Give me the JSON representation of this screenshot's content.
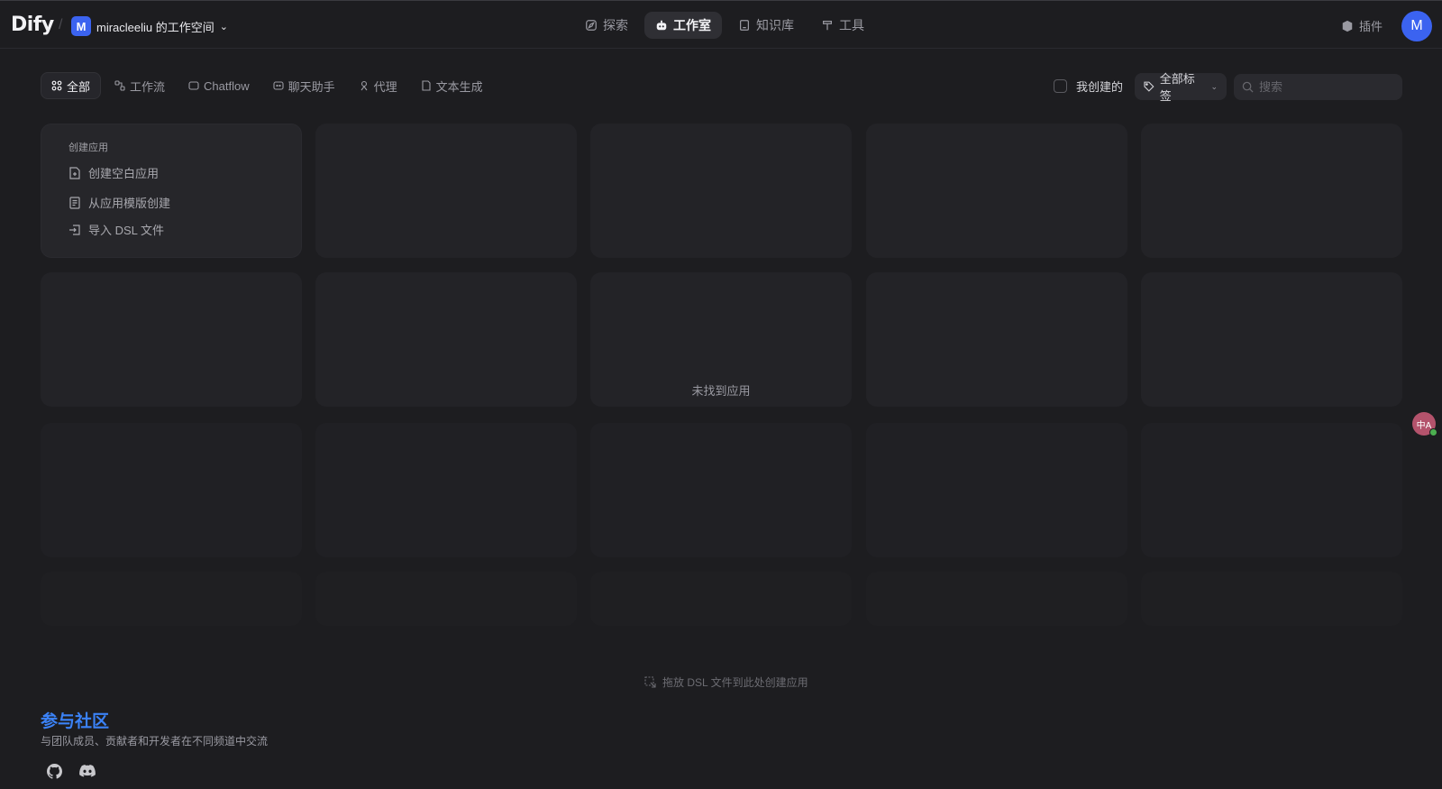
{
  "header": {
    "logo": "Dify",
    "workspace": {
      "initial": "M",
      "name": "miracleeliu 的工作空间"
    },
    "nav": [
      {
        "label": "探索",
        "icon": "explore-icon",
        "active": false
      },
      {
        "label": "工作室",
        "icon": "robot-icon",
        "active": true
      },
      {
        "label": "知识库",
        "icon": "book-icon",
        "active": false
      },
      {
        "label": "工具",
        "icon": "hammer-icon",
        "active": false
      }
    ],
    "plugins_label": "插件",
    "user_initial": "M"
  },
  "filters": {
    "tabs": [
      {
        "label": "全部",
        "active": true
      },
      {
        "label": "工作流",
        "active": false
      },
      {
        "label": "Chatflow",
        "active": false
      },
      {
        "label": "聊天助手",
        "active": false
      },
      {
        "label": "代理",
        "active": false
      },
      {
        "label": "文本生成",
        "active": false
      }
    ],
    "mine_label": "我创建的",
    "mine_checked": false,
    "tag_filter_label": "全部标签",
    "search_placeholder": "搜索"
  },
  "create_card": {
    "title": "创建应用",
    "options": [
      "创建空白应用",
      "从应用模版创建",
      "导入 DSL 文件"
    ]
  },
  "empty_state": "未找到应用",
  "drop_hint": "拖放 DSL 文件到此处创建应用",
  "community": {
    "title": "参与社区",
    "description": "与团队成员、贡献者和开发者在不同频道中交流",
    "links": [
      "github-icon",
      "discord-icon"
    ]
  },
  "translate_fab": "中A",
  "colors": {
    "accent": "#3b63f0",
    "link": "#3b82f6",
    "background": "#1d1d20"
  }
}
